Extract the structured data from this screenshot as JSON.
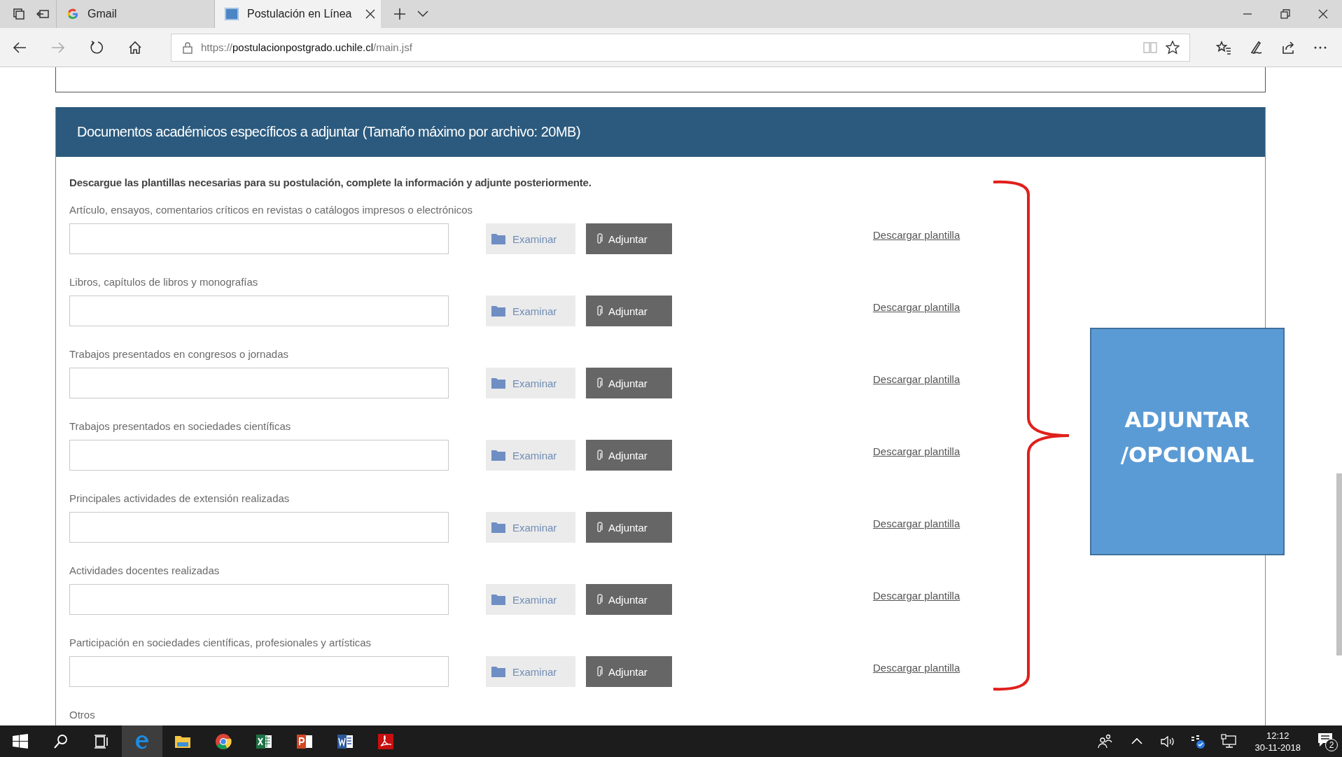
{
  "browser": {
    "tabs": [
      {
        "label": "Gmail",
        "selected": false
      },
      {
        "label": "Postulación en Línea",
        "selected": true
      }
    ],
    "url": {
      "scheme": "https://",
      "host": "postulacionpostgrado.uchile.cl",
      "path": "/main.jsf"
    }
  },
  "section": {
    "title": "Documentos académicos específicos a adjuntar (Tamaño máximo por archivo: 20MB)",
    "instructions": "Descargue las plantillas necesarias para su postulación, complete la información y adjunte posteriormente.",
    "documents": [
      {
        "label": "Artículo, ensayos, comentarios críticos en revistas o catálogos impresos o electrónicos",
        "browse_button": "Examinar",
        "attach_button": "Adjuntar",
        "download_link": "Descargar plantilla"
      },
      {
        "label": "Libros, capítulos de libros y monografías",
        "browse_button": "Examinar",
        "attach_button": "Adjuntar",
        "download_link": "Descargar plantilla"
      },
      {
        "label": "Trabajos presentados en congresos o jornadas",
        "browse_button": "Examinar",
        "attach_button": "Adjuntar",
        "download_link": "Descargar plantilla"
      },
      {
        "label": "Trabajos presentados en sociedades científicas",
        "browse_button": "Examinar",
        "attach_button": "Adjuntar",
        "download_link": "Descargar plantilla"
      },
      {
        "label": "Principales actividades de extensión realizadas",
        "browse_button": "Examinar",
        "attach_button": "Adjuntar",
        "download_link": "Descargar plantilla"
      },
      {
        "label": "Actividades docentes realizadas",
        "browse_button": "Examinar",
        "attach_button": "Adjuntar",
        "download_link": "Descargar plantilla"
      },
      {
        "label": "Participación en sociedades científicas, profesionales y artísticas",
        "browse_button": "Examinar",
        "attach_button": "Adjuntar",
        "download_link": "Descargar plantilla"
      },
      {
        "label": "Otros"
      }
    ]
  },
  "annotation": {
    "lines": [
      "ADJUNTAR",
      "/OPCIONAL"
    ]
  },
  "taskbar": {
    "time": "12:12",
    "date": "30-11-2018",
    "notification_count": "2"
  }
}
